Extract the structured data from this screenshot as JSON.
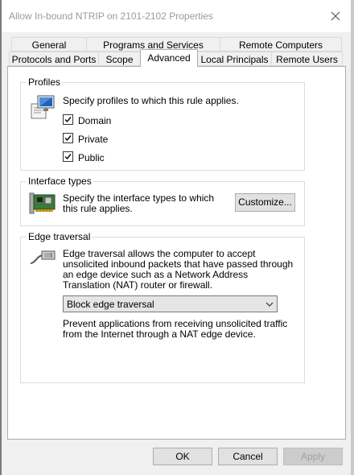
{
  "window": {
    "title": "Allow In-bound NTRIP on 2101-2102 Properties"
  },
  "icons": {
    "close": "close-icon",
    "profiles": "computer-monitor-icon",
    "interfaces": "network-card-icon",
    "edge": "network-cable-icon",
    "checkmark": "checkmark-icon",
    "dropdown": "chevron-down-icon"
  },
  "tabs": {
    "row1": [
      {
        "label": "General"
      },
      {
        "label": "Programs and Services"
      },
      {
        "label": "Remote Computers"
      }
    ],
    "row2": [
      {
        "label": "Protocols and Ports"
      },
      {
        "label": "Scope"
      },
      {
        "label": "Advanced"
      },
      {
        "label": "Local Principals"
      },
      {
        "label": "Remote Users"
      }
    ],
    "active": "Advanced"
  },
  "profiles": {
    "title": "Profiles",
    "description": "Specify profiles to which this rule applies.",
    "items": [
      {
        "label": "Domain",
        "checked": true
      },
      {
        "label": "Private",
        "checked": true
      },
      {
        "label": "Public",
        "checked": true
      }
    ]
  },
  "interface_types": {
    "title": "Interface types",
    "description": "Specify the interface types to which this rule applies.",
    "customize_label": "Customize..."
  },
  "edge_traversal": {
    "title": "Edge traversal",
    "description": "Edge traversal allows the computer to accept unsolicited inbound packets that have passed through an edge device such as a Network Address Translation (NAT) router or firewall.",
    "selected": "Block edge traversal",
    "selected_help": "Prevent applications from receiving unsolicited traffic from the Internet through a NAT edge device."
  },
  "footer": {
    "ok_label": "OK",
    "cancel_label": "Cancel",
    "apply_label": "Apply"
  }
}
